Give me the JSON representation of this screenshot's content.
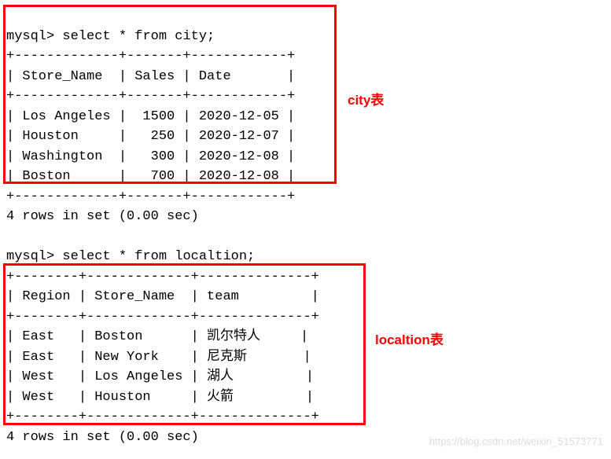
{
  "query1": {
    "prompt": "mysql> ",
    "statement": "select * from city;",
    "sep_top": "+-------------+-------+------------+",
    "header": "| Store_Name  | Sales | Date       |",
    "sep_mid": "+-------------+-------+------------+",
    "rows": [
      "| Los Angeles |  1500 | 2020-12-05 |",
      "| Houston     |   250 | 2020-12-07 |",
      "| Washington  |   300 | 2020-12-08 |",
      "| Boston      |   700 | 2020-12-08 |"
    ],
    "sep_bot": "+-------------+-------+------------+",
    "footer": "4 rows in set (0.00 sec)"
  },
  "query2": {
    "prompt": "mysql> ",
    "statement": "select * from localtion;",
    "sep_top": "+--------+-------------+--------------+",
    "header": "| Region | Store_Name  | team         |",
    "sep_mid": "+--------+-------------+--------------+",
    "rows": [
      "| East   | Boston      | 凯尔特人     |",
      "| East   | New York    | 尼克斯       |",
      "| West   | Los Angeles | 湖人         |",
      "| West   | Houston     | 火箭         |"
    ],
    "sep_bot": "+--------+-------------+--------------+",
    "footer": "4 rows in set (0.00 sec)"
  },
  "labels": {
    "city": "city表",
    "location": "localtion表"
  },
  "watermark": "https://blog.csdn.net/weixin_51573771"
}
